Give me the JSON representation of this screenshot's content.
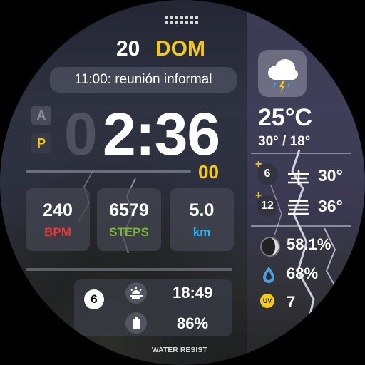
{
  "date": {
    "day_number": "20",
    "weekday": "DOM"
  },
  "event": {
    "text": "11:00: reunión informal"
  },
  "clock": {
    "am_label": "A",
    "pm_label": "P",
    "hour_leading_ghost": "0",
    "time": "2:36",
    "seconds": "00"
  },
  "stats": [
    {
      "value": "240",
      "unit": "BPM",
      "unit_color": "#e53935"
    },
    {
      "value": "6579",
      "unit": "STEPS",
      "unit_color": "#7cb342"
    },
    {
      "value": "5.0",
      "unit": "km",
      "unit_color": "#29b6f6"
    }
  ],
  "bottom": {
    "badge": "6",
    "sunset_time": "18:49",
    "battery": "86%",
    "sunset_icon": "sunset-icon",
    "battery_icon": "battery-icon"
  },
  "footer": {
    "label": "WATER RESIST"
  },
  "weather": {
    "icon": "thunderstorm-icon",
    "temperature": "25°C",
    "min_max": "30° / 18°"
  },
  "forecast": [
    {
      "hours": "6",
      "icon": "fog-icon",
      "temp": "30°"
    },
    {
      "hours": "12",
      "icon": "haze-icon",
      "temp": "36°"
    }
  ],
  "conditions": {
    "moon": "58.1%",
    "humidity": "68%",
    "uv_label": "UV",
    "uv": "7"
  },
  "colors": {
    "accent": "#f6c915",
    "bpm": "#e53935",
    "steps": "#7cb342",
    "km": "#29b6f6"
  }
}
